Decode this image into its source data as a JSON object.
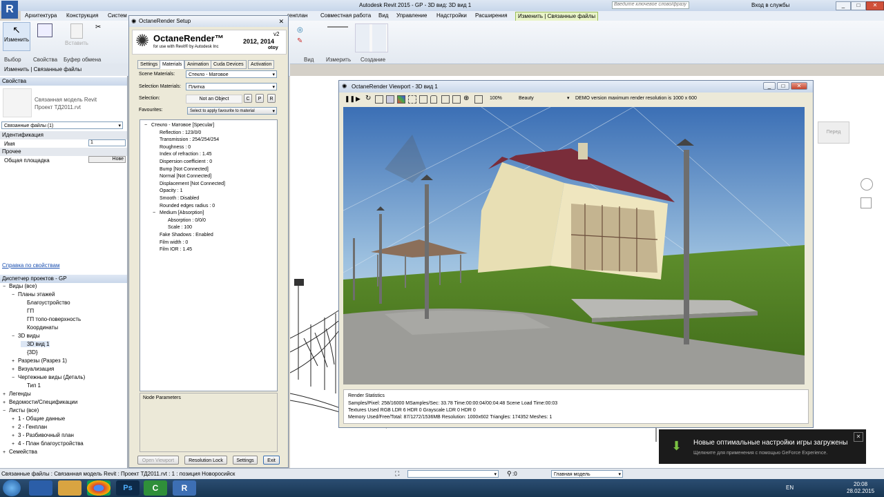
{
  "app": {
    "title": "Autodesk Revit 2015  -   GP - 3D вид: 3D вид 1",
    "search_placeholder": "Введите ключевое слово/фразу",
    "login": "Вход в службы"
  },
  "ribbon_tabs": [
    "Архитектура",
    "Конструкция",
    "Систем",
    "генплан",
    "Совместная работа",
    "Вид",
    "Управление",
    "Надстройки",
    "Расширения",
    "Изменить | Связанные файлы"
  ],
  "ribbon_groups": [
    "Выбор",
    "Свойства",
    "Буфер обмена",
    "Вид",
    "Измерить",
    "Создание"
  ],
  "ribbon_buttons": {
    "modify": "Изменить",
    "properties": "Свойства",
    "paste": "Вставить"
  },
  "context_bar": "Изменить | Связанные файлы",
  "properties": {
    "header": "Свойства",
    "type_line1": "Связанная модель Revit",
    "type_line2": "Проект ТД2011.rvt",
    "selector": "Связанные файлы (1)",
    "identification": "Идентификация",
    "name_label": "Имя",
    "name_value": "1",
    "other": "Прочее",
    "area_label": "Общая площадка",
    "area_button": "Нове",
    "help_link": "Справка по свойствам"
  },
  "project_browser": {
    "header": "Диспетчер проектов - GP",
    "items": [
      {
        "label": "Виды (все)",
        "level": 0,
        "expander": "−"
      },
      {
        "label": "Планы этажей",
        "level": 1,
        "expander": "−"
      },
      {
        "label": "Благоустройство",
        "level": 2,
        "expander": ""
      },
      {
        "label": "ГП",
        "level": 2,
        "expander": ""
      },
      {
        "label": "ГП топо-поверхность",
        "level": 2,
        "expander": ""
      },
      {
        "label": "Координаты",
        "level": 2,
        "expander": ""
      },
      {
        "label": "3D виды",
        "level": 1,
        "expander": "−"
      },
      {
        "label": "3D вид 1",
        "level": 2,
        "expander": "",
        "bold": true
      },
      {
        "label": "{3D}",
        "level": 2,
        "expander": ""
      },
      {
        "label": "Разрезы (Разрез 1)",
        "level": 1,
        "expander": "+"
      },
      {
        "label": "Визуализация",
        "level": 1,
        "expander": "+"
      },
      {
        "label": "Чертежные виды (Деталь)",
        "level": 1,
        "expander": "−"
      },
      {
        "label": "Тип 1",
        "level": 2,
        "expander": ""
      },
      {
        "label": "Легенды",
        "level": 0,
        "expander": "+"
      },
      {
        "label": "Ведомости/Спецификации",
        "level": 0,
        "expander": "+"
      },
      {
        "label": "Листы (все)",
        "level": 0,
        "expander": "−"
      },
      {
        "label": "1 - Общие данные",
        "level": 1,
        "expander": "+"
      },
      {
        "label": "2 - Генплан",
        "level": 1,
        "expander": "+"
      },
      {
        "label": "3 - Разбивочный план",
        "level": 1,
        "expander": "+"
      },
      {
        "label": "4 - План благоустройства",
        "level": 1,
        "expander": "+"
      },
      {
        "label": "Семейства",
        "level": 0,
        "expander": "+"
      }
    ]
  },
  "octane_setup": {
    "title": "OctaneRender Setup",
    "logo": "OctaneRender™",
    "logo_sub": "for use with Revit® by Autodesk Inc",
    "version": "v2",
    "years": "2012, 2014",
    "brand": "otoy",
    "tabs": [
      "Settings",
      "Materials",
      "Animation",
      "Cuda Devices",
      "Activation"
    ],
    "active_tab": "Materials",
    "scene_materials_label": "Scene Materials:",
    "scene_materials_value": "Стекло - Матовое",
    "selection_materials_label": "Selection Materials:",
    "selection_materials_value": "Плитка",
    "selection_label": "Selection:",
    "selection_value": "Not an Object",
    "btn_c": "C",
    "btn_p": "P",
    "btn_r": "R",
    "favourites_label": "Favourites:",
    "favourites_value": "Select to apply favourite to material",
    "tree": [
      {
        "label": "Стекло - Матовое  [Specular]",
        "level": 0,
        "expander": "−"
      },
      {
        "label": "Reflection : 123/0/0",
        "level": 1
      },
      {
        "label": "Transmission : 254/254/254",
        "level": 1
      },
      {
        "label": "Roughness : 0",
        "level": 1
      },
      {
        "label": "Index of refraction : 1.45",
        "level": 1
      },
      {
        "label": "Dispersion coefficient : 0",
        "level": 1
      },
      {
        "label": "Bump  [Not Connected]",
        "level": 1
      },
      {
        "label": "Normal  [Not Connected]",
        "level": 1
      },
      {
        "label": "Displacement  [Not Connected]",
        "level": 1
      },
      {
        "label": "Opacity : 1",
        "level": 1
      },
      {
        "label": "Smooth : Disabled",
        "level": 1
      },
      {
        "label": "Rounded edges radius : 0",
        "level": 1
      },
      {
        "label": "Medium  [Absorption]",
        "level": 1,
        "expander": "−"
      },
      {
        "label": "Absorption : 0/0/0",
        "level": 2
      },
      {
        "label": "Scale : 100",
        "level": 2
      },
      {
        "label": "Fake Shadows : Enabled",
        "level": 1
      },
      {
        "label": "Film width : 0",
        "level": 1
      },
      {
        "label": "Film IOR : 1.45",
        "level": 1
      }
    ],
    "node_params": "Node Parameters",
    "btn_open_viewport": "Open Viewport",
    "btn_resolution_lock": "Resolution Lock",
    "btn_settings": "Settings",
    "btn_exit": "Exit"
  },
  "octane_viewport": {
    "title": "OctaneRender Viewport - 3D вид 1",
    "zoom": "100%",
    "pass": "Beauty",
    "demo_notice": "DEMO version maximum render resolution is 1000 x 600",
    "stats_title": "Render Statistics",
    "stats_line1": "Samples/Pixel: 258/16000  MSamples/Sec: 33.78  Time:00:00:04/00:04:48  Scene Load Time:00:03",
    "stats_line2": "Textures Used RGB LDR 6  HDR 0  Grayscale LDR 0  HDR 0",
    "stats_line3": "Memory Used/Free/Total: 87/1272/1536MB  Resolution: 1000x602  Triangles: 174352  Meshes: 1"
  },
  "view_cube": {
    "face": "Перед"
  },
  "status_bar": {
    "text": "Связанные файлы : Связанная модель Revit : Проект ТД2011.rvt : 1 : позиция Новоросийск",
    "counter": ":0",
    "model": "Главная модель"
  },
  "notification": {
    "title": "Новые оптимальные настройки игры загружены",
    "body": "Щелкните для применения с помощью GeForce Experience."
  },
  "taskbar": {
    "lang": "EN",
    "time": "20:08",
    "date": "28.02.2015",
    "apps": [
      "file-manager-icon",
      "explorer-icon",
      "chrome-icon",
      "photoshop-icon",
      "camtasia-icon",
      "revit-icon"
    ]
  },
  "colors": {
    "ribbon_active": "#f6d87a",
    "taskbar": "#1f3e60",
    "accent": "#3d6fb4"
  }
}
